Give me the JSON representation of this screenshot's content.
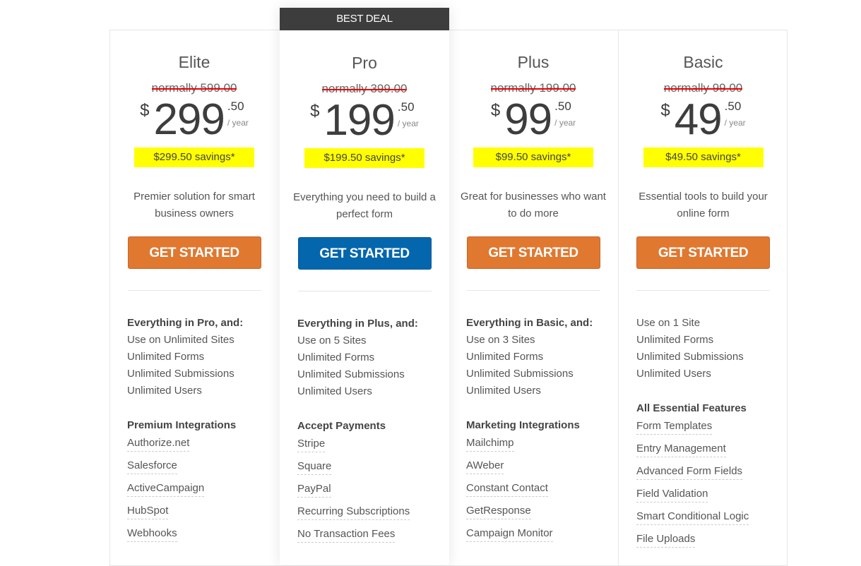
{
  "badge": "BEST DEAL",
  "colors": {
    "orange_button": "#e07830",
    "blue_button": "#0466ac",
    "savings_highlight": "#ffff00",
    "strike": "#e00000",
    "badge_bg": "#3d3d3d"
  },
  "plans": [
    {
      "name": "Elite",
      "normally": "normally 599.00",
      "currency": "$",
      "amount": "299",
      "cents": ".50",
      "period": "/ year",
      "savings": "$299.50 savings*",
      "description": "Premier solution for smart business owners",
      "cta": "GET STARTED",
      "features_head": "Everything in Pro, and:",
      "features": [
        "Use on Unlimited Sites",
        "Unlimited Forms",
        "Unlimited Submissions",
        "Unlimited Users"
      ],
      "section_title": "Premium Integrations",
      "section_items": [
        "Authorize.net",
        "Salesforce",
        "ActiveCampaign",
        "HubSpot",
        "Webhooks"
      ]
    },
    {
      "name": "Pro",
      "normally": "normally 399.00",
      "currency": "$",
      "amount": "199",
      "cents": ".50",
      "period": "/ year",
      "savings": "$199.50 savings*",
      "description": "Everything you need to build a perfect form",
      "cta": "GET STARTED",
      "features_head": "Everything in Plus, and:",
      "features": [
        "Use on 5 Sites",
        "Unlimited Forms",
        "Unlimited Submissions",
        "Unlimited Users"
      ],
      "section_title": "Accept Payments",
      "section_items": [
        "Stripe",
        "Square",
        "PayPal",
        "Recurring Subscriptions",
        "No Transaction Fees"
      ]
    },
    {
      "name": "Plus",
      "normally": "normally 199.00",
      "currency": "$",
      "amount": "99",
      "cents": ".50",
      "period": "/ year",
      "savings": "$99.50 savings*",
      "description": "Great for businesses who want to do more",
      "cta": "GET STARTED",
      "features_head": "Everything in Basic, and:",
      "features": [
        "Use on 3 Sites",
        "Unlimited Forms",
        "Unlimited Submissions",
        "Unlimited Users"
      ],
      "section_title": "Marketing Integrations",
      "section_items": [
        "Mailchimp",
        "AWeber",
        "Constant Contact",
        "GetResponse",
        "Campaign Monitor"
      ]
    },
    {
      "name": "Basic",
      "normally": "normally 99.00",
      "currency": "$",
      "amount": "49",
      "cents": ".50",
      "period": "/ year",
      "savings": "$49.50 savings*",
      "description": "Essential tools to build your online form",
      "cta": "GET STARTED",
      "features_head": "",
      "features": [
        "Use on 1 Site",
        "Unlimited Forms",
        "Unlimited Submissions",
        "Unlimited Users"
      ],
      "section_title": "All Essential Features",
      "section_items": [
        "Form Templates",
        "Entry Management",
        "Advanced Form Fields",
        "Field Validation",
        "Smart Conditional Logic",
        "File Uploads"
      ]
    }
  ]
}
